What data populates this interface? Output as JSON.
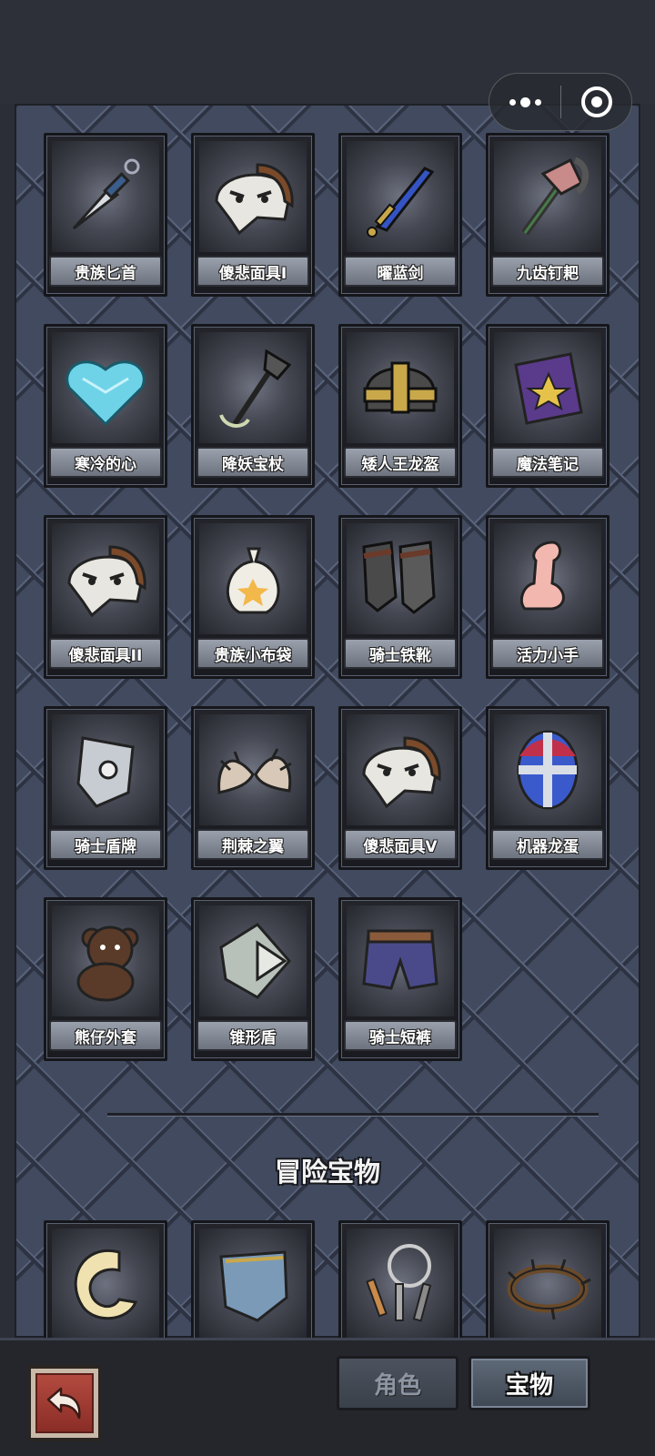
{
  "capsule": {
    "menu_icon": "more-dots-icon",
    "close_icon": "close-circle-icon"
  },
  "items": [
    {
      "name": "贵族匕首",
      "icon": "dagger-icon"
    },
    {
      "name": "傻悲面具I",
      "icon": "mask-icon"
    },
    {
      "name": "曜蓝剑",
      "icon": "blue-sword-icon"
    },
    {
      "name": "九齿钉耙",
      "icon": "rake-icon"
    },
    {
      "name": "寒冷的心",
      "icon": "ice-heart-icon"
    },
    {
      "name": "降妖宝杖",
      "icon": "staff-icon"
    },
    {
      "name": "矮人王龙盔",
      "icon": "helmet-icon"
    },
    {
      "name": "魔法笔记",
      "icon": "spellbook-icon"
    },
    {
      "name": "傻悲面具II",
      "icon": "mask-icon"
    },
    {
      "name": "贵族小布袋",
      "icon": "pouch-icon"
    },
    {
      "name": "骑士铁靴",
      "icon": "boots-icon"
    },
    {
      "name": "活力小手",
      "icon": "hand-icon"
    },
    {
      "name": "骑士盾牌",
      "icon": "shield-icon"
    },
    {
      "name": "荆棘之翼",
      "icon": "wings-icon"
    },
    {
      "name": "傻悲面具V",
      "icon": "mask-icon"
    },
    {
      "name": "机器龙蛋",
      "icon": "egg-icon"
    },
    {
      "name": "熊仔外套",
      "icon": "teddy-bear-icon"
    },
    {
      "name": "锥形盾",
      "icon": "cone-shield-icon"
    },
    {
      "name": "骑士短裤",
      "icon": "shorts-icon"
    }
  ],
  "adventure_section": {
    "title": "冒险宝物",
    "items": [
      {
        "icon": "ring-donut-icon"
      },
      {
        "icon": "armor-plate-icon"
      },
      {
        "icon": "keys-icon"
      },
      {
        "icon": "thorn-crown-icon"
      }
    ]
  },
  "bottom_bar": {
    "back_icon": "back-arrow-icon",
    "tabs": [
      {
        "label": "角色",
        "active": false
      },
      {
        "label": "宝物",
        "active": true
      }
    ]
  }
}
